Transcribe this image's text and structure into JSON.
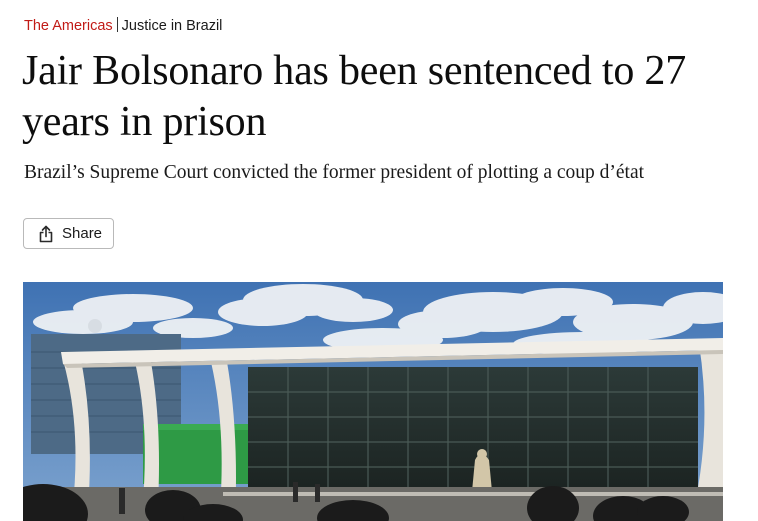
{
  "breadcrumb": {
    "section": "The Americas",
    "topic": "Justice in Brazil"
  },
  "article": {
    "headline": "Jair Bolsonaro has been sentenced to 27 years in prison",
    "standfirst": "Brazil’s Supreme Court convicted the former president of plotting a coup d’état"
  },
  "share": {
    "label": "Share",
    "icon": "share-icon"
  },
  "colors": {
    "section_accent": "#c11b17",
    "text": "#0d0d0d",
    "button_border": "#b9b9b9"
  }
}
